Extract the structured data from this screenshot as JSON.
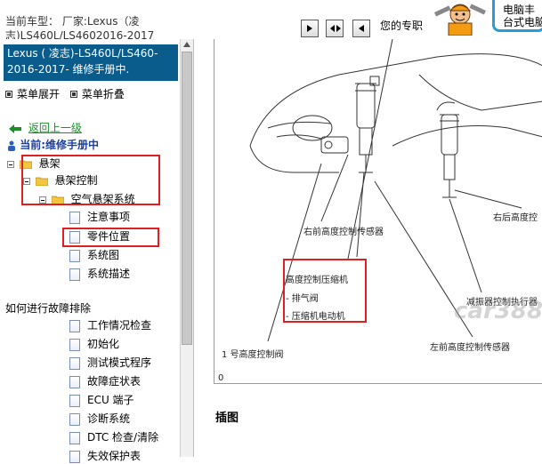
{
  "header": {
    "vehicle_line1": "当前车型： 厂家:Lexus（凌",
    "vehicle_line2": "志)LS460L/LS4602016-2017",
    "promo_text": "您的专职",
    "bubble_line1": "电脑丰",
    "bubble_line2": "台式电脑"
  },
  "sidebar": {
    "title": "Lexus ( 凌志)-LS460L/LS460-2016-2017- 维修手册中.",
    "expand_all": "菜单展开",
    "collapse_all": "菜单折叠",
    "back": "返回上一级",
    "current": "当前:维修手册中",
    "tree": {
      "suspension": "悬架",
      "suspension_control": "悬架控制",
      "air_suspension": "空气悬架系统",
      "notes": "注意事项",
      "parts_location": "零件位置",
      "system_diagram": "系统图",
      "system_description": "系统描述",
      "how_to_troubleshoot": "如何进行故障排除",
      "operation_check": "工作情况检查",
      "initialization": "初始化",
      "test_mode": "测试模式程序",
      "symptom_table": "故障症状表",
      "ecu_terminals": "ECU 端子",
      "diag_system": "诊断系统",
      "dtc_check": "DTC 检查/清除",
      "fail_safe": "失效保护表"
    }
  },
  "diagram": {
    "label_right_front_sensor": "右前高度控制传感器",
    "label_right_rear": "右后高度控",
    "label_compressor_title": "高度控制压缩机",
    "label_exhaust_valve": "- 排气阀",
    "label_compressor_motor": "- 压缩机电动机",
    "label_shock_actuator": "减振器控制执行器",
    "label_left_front_sensor": "左前高度控制传感器",
    "label_no1_valve": "1 号高度控制阀",
    "label_zero": "0",
    "watermark": "car388"
  },
  "content": {
    "section_heading": "插图"
  },
  "colors": {
    "title_bg": "#0a5c8c",
    "highlight_red": "#e02020",
    "link_green": "#1a8f2a",
    "current_blue": "#1a3fa3",
    "bubble_blue": "#2a9bd6"
  }
}
